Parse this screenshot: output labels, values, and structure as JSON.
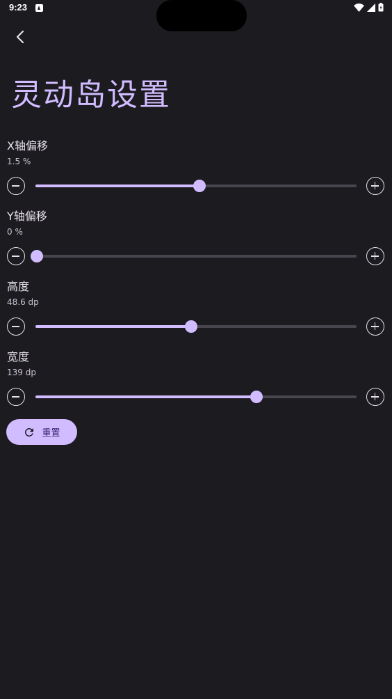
{
  "status_bar": {
    "time": "9:23"
  },
  "page": {
    "title": "灵动岛设置"
  },
  "settings": [
    {
      "label": "X轴偏移",
      "value": "1.5 %",
      "fraction": 0.51
    },
    {
      "label": "Y轴偏移",
      "value": "0 %",
      "fraction": 0.0
    },
    {
      "label": "高度",
      "value": "48.6 dp",
      "fraction": 0.485
    },
    {
      "label": "宽度",
      "value": "139 dp",
      "fraction": 0.69
    }
  ],
  "reset": {
    "label": "重置"
  },
  "icons": {
    "back": "arrow-back-icon",
    "minus": "remove-circle-icon",
    "plus": "add-circle-icon",
    "reset": "refresh-icon"
  },
  "colors": {
    "background": "#1c1b20",
    "accent": "#d0bcff",
    "track": "#49454f"
  }
}
